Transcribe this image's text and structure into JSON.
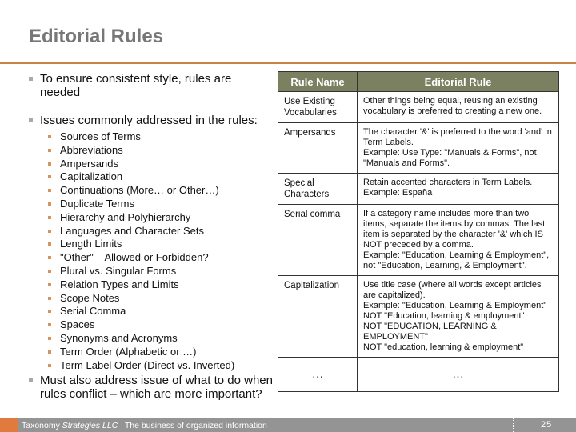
{
  "slide": {
    "title": "Editorial Rules",
    "bullets": [
      "To ensure consistent style, rules are needed",
      "Issues commonly addressed in the rules:"
    ],
    "issues": [
      "Sources of Terms",
      "Abbreviations",
      "Ampersands",
      "Capitalization",
      "Continuations (More… or Other…)",
      "Duplicate Terms",
      "Hierarchy and Polyhierarchy",
      "Languages and Character Sets",
      "Length Limits",
      "\"Other\" – Allowed or Forbidden?",
      "Plural vs. Singular Forms",
      "Relation Types and Limits",
      "Scope Notes",
      "Serial Comma",
      "Spaces",
      "Synonyms and Acronyms",
      "Term Order (Alphabetic or …)",
      "Term Label Order (Direct vs. Inverted)"
    ],
    "last_bullet": "Must also address issue of what to do when rules conflict – which are more important?"
  },
  "table": {
    "headers": [
      "Rule Name",
      "Editorial Rule"
    ],
    "rows": [
      {
        "name": "Use Existing Vocabularies",
        "rule": [
          "Other things being equal, reusing an existing vocabulary is preferred to creating a new one."
        ]
      },
      {
        "name": "Ampersands",
        "rule": [
          "The character '&' is preferred to the word 'and' in Term Labels.",
          "Example: Use Type: \"Manuals & Forms\", not \"Manuals and Forms\"."
        ]
      },
      {
        "name": "Special Characters",
        "rule": [
          "Retain accented characters in Term Labels.",
          "Example: España"
        ]
      },
      {
        "name": "Serial comma",
        "rule": [
          "If a category name includes more than two items, separate the items by commas. The last item is separated by the character '&' which IS NOT preceded by a comma.",
          "Example:  \"Education, Learning & Employment\", not \"Education, Learning, & Employment\"."
        ]
      },
      {
        "name": "Capitalization",
        "rule": [
          "Use title case (where all words except articles are capitalized).",
          "Example: \"Education, Learning & Employment\"",
          "NOT \"Education, learning & employment\"",
          "NOT \"EDUCATION, LEARNING & EMPLOYMENT\"",
          "NOT \"education, learning & employment\""
        ]
      },
      {
        "name": "…",
        "rule": [
          "…"
        ]
      }
    ]
  },
  "footer": {
    "company_prefix": "Taxonomy",
    "company_italic": "Strategies LLC",
    "tagline": "The business of organized information",
    "page_number": "25"
  },
  "colors": {
    "title": "#777777",
    "rule_line": "#c8834a",
    "table_header": "#7b8060",
    "footer_bg": "#949494",
    "footer_mark": "#e07a3e"
  }
}
